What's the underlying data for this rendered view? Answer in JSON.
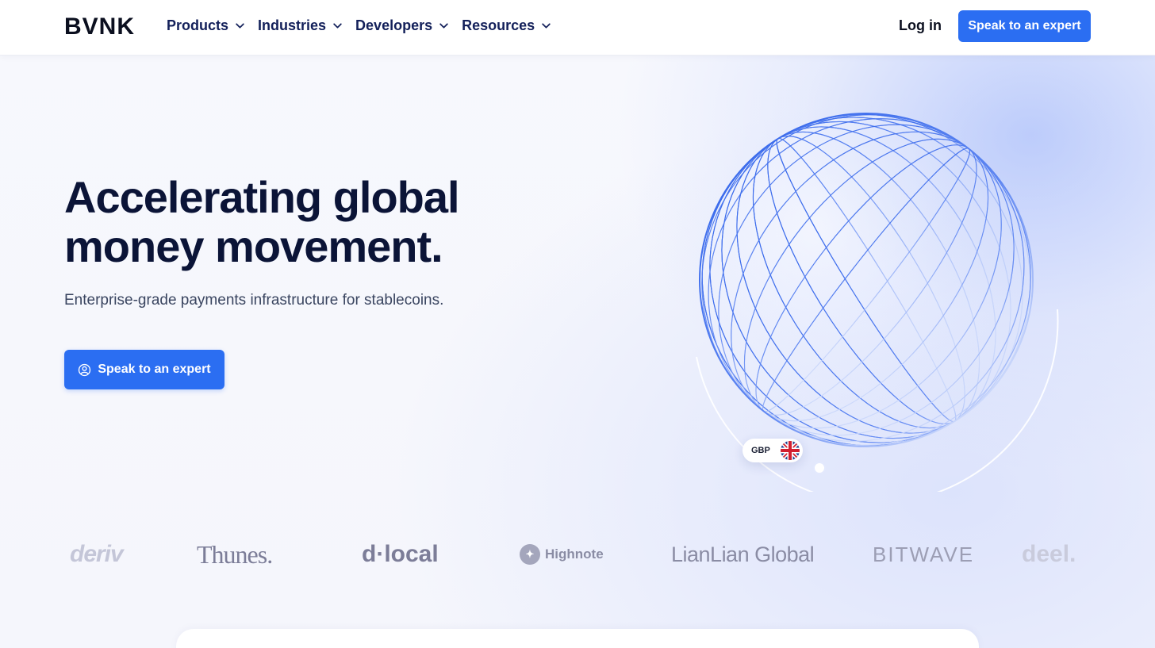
{
  "nav": {
    "logo": "BVNK",
    "items": [
      {
        "label": "Products"
      },
      {
        "label": "Industries"
      },
      {
        "label": "Developers"
      },
      {
        "label": "Resources"
      }
    ],
    "login": "Log in",
    "cta": "Speak to an expert"
  },
  "hero": {
    "headline_line1": "Accelerating global",
    "headline_line2": "money movement.",
    "subhead": "Enterprise-grade payments infrastructure for stablecoins.",
    "cta": "Speak to an expert",
    "cta_icon": "user-circle-icon",
    "currency_badge": {
      "code": "GBP",
      "flag": "uk-flag-icon"
    }
  },
  "partners": [
    {
      "name": "deriv"
    },
    {
      "name": "Thunes."
    },
    {
      "name": "d·local"
    },
    {
      "name": "Highnote"
    },
    {
      "name": "LianLian Global"
    },
    {
      "name": "BITWAVE"
    },
    {
      "name": "deel."
    }
  ],
  "colors": {
    "accent": "#2b6ef2",
    "heading": "#0b1437",
    "nav_text": "#13205a"
  }
}
